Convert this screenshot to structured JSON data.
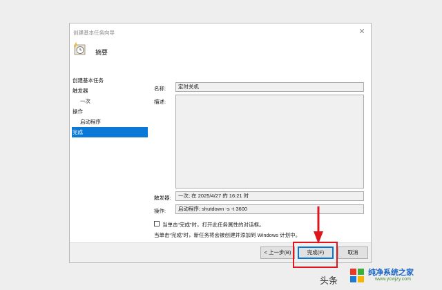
{
  "window": {
    "title": "创建基本任务向导",
    "close_glyph": "✕"
  },
  "header": {
    "title": "摘要",
    "icon": "task-clock-icon"
  },
  "nav": {
    "items": [
      {
        "label": "创建基本任务",
        "sub": false,
        "active": false
      },
      {
        "label": "触发器",
        "sub": false,
        "active": false
      },
      {
        "label": "一次",
        "sub": true,
        "active": false
      },
      {
        "label": "操作",
        "sub": false,
        "active": false
      },
      {
        "label": "启动程序",
        "sub": true,
        "active": false
      },
      {
        "label": "完成",
        "sub": false,
        "active": true
      }
    ]
  },
  "summary": {
    "name_label": "名称:",
    "name_value": "定时关机",
    "description_label": "描述:",
    "description_value": "",
    "trigger_label": "触发器:",
    "trigger_value": "一次; 在 2025/4/27 的 16:21 时",
    "action_label": "操作:",
    "action_value": "启动程序; shutdown -s -t 3600"
  },
  "options": {
    "open_properties_label": "当单击“完成”时，打开此任务属性的对话框。",
    "open_properties_checked": false,
    "note": "当单击“完成”时，新任务将会被创建并添加到 Windows 计划中。"
  },
  "footer": {
    "back_label": "< 上一步(B)",
    "finish_label": "完成(F)",
    "cancel_label": "取消"
  },
  "watermark": {
    "source": "头条",
    "brand": "纯净系统之家",
    "url": "www.ycwjzy.com"
  },
  "colors": {
    "accent": "#0a78d7",
    "highlight": "#e0141c"
  }
}
